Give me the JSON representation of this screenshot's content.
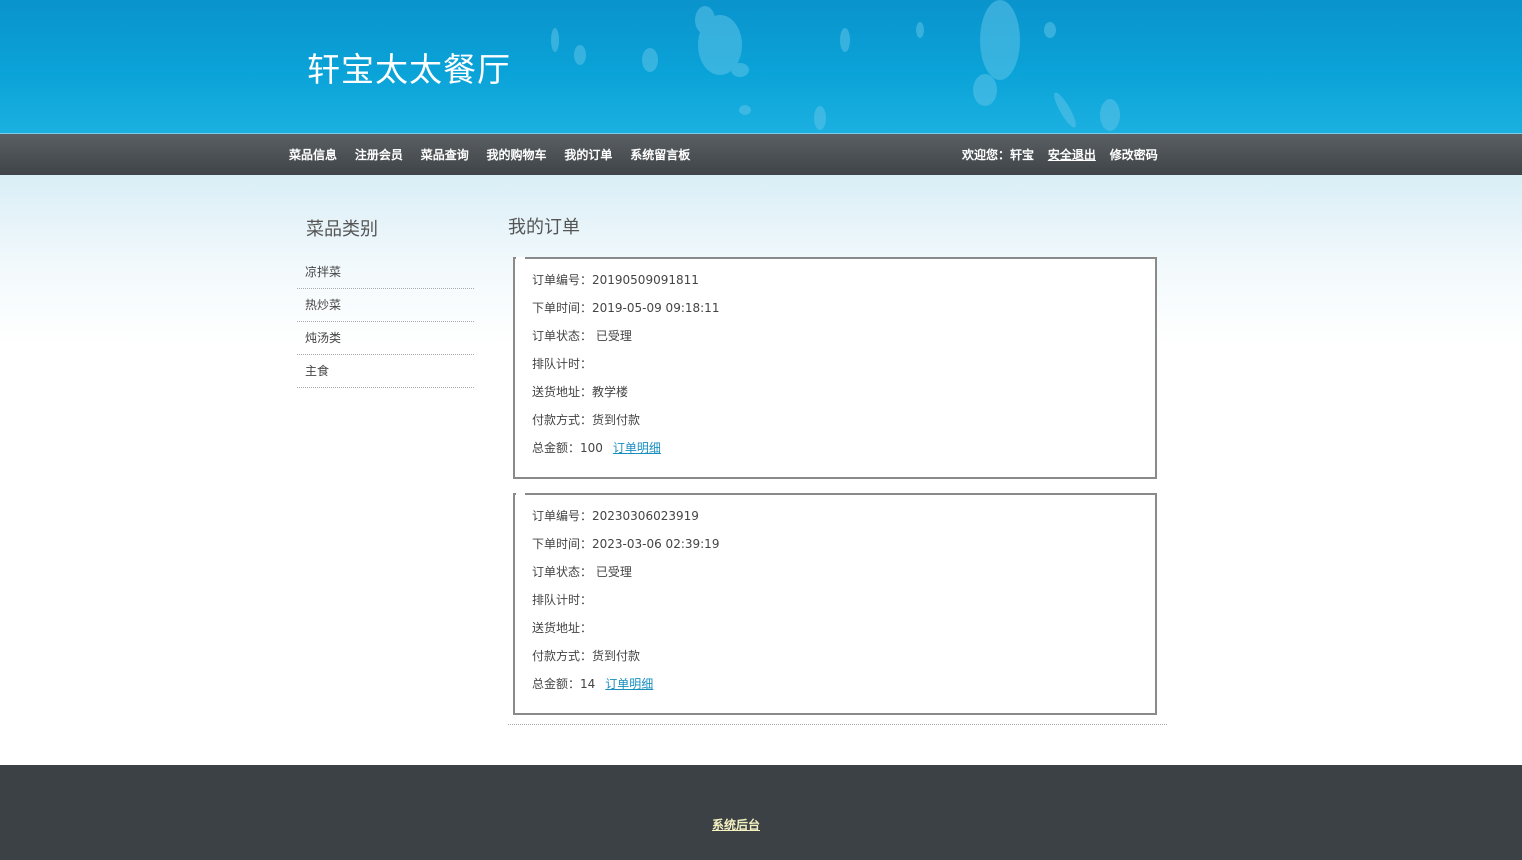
{
  "header": {
    "site_title": "轩宝太太餐厅"
  },
  "nav": {
    "items": [
      {
        "label": "菜品信息"
      },
      {
        "label": "注册会员"
      },
      {
        "label": "菜品查询"
      },
      {
        "label": "我的购物车"
      },
      {
        "label": "我的订单"
      },
      {
        "label": "系统留言板"
      }
    ],
    "welcome": "欢迎您：轩宝",
    "logout": "安全退出",
    "change_password": "修改密码"
  },
  "sidebar": {
    "title": "菜品类别",
    "categories": [
      {
        "label": "凉拌菜"
      },
      {
        "label": "热炒菜"
      },
      {
        "label": "炖汤类"
      },
      {
        "label": "主食"
      }
    ]
  },
  "main": {
    "title": "我的订单",
    "orders": [
      {
        "order_no": "订单编号：20190509091811",
        "order_time": "下单时间：2019-05-09 09:18:11",
        "status": "订单状态： 已受理",
        "queue": "排队计时：",
        "address": "送货地址：教学楼",
        "payment": "付款方式：货到付款",
        "total": "总金额：100",
        "detail_link": "订单明细"
      },
      {
        "order_no": "订单编号：20230306023919",
        "order_time": "下单时间：2023-03-06 02:39:19",
        "status": "订单状态： 已受理",
        "queue": "排队计时：",
        "address": "送货地址：",
        "payment": "付款方式：货到付款",
        "total": "总金额：14",
        "detail_link": "订单明细"
      }
    ]
  },
  "footer": {
    "admin_link": "系统后台"
  }
}
